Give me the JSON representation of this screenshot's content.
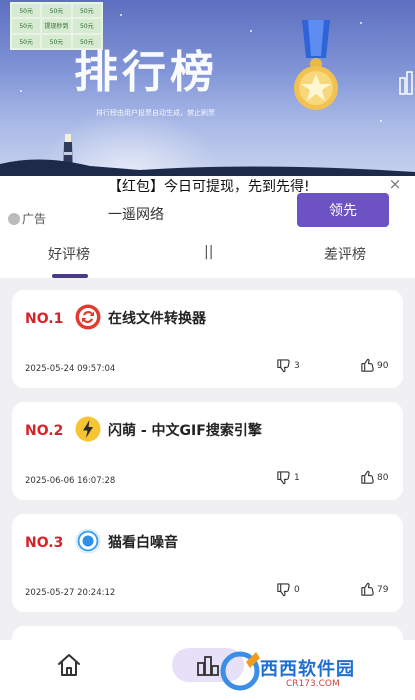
{
  "header": {
    "title": "排行榜",
    "subtitle": "排行榜由用户投票自动生成，禁止刷票"
  },
  "ad": {
    "title": "【红包】今日可提现，先到先得!",
    "brand": "一遥网络",
    "button_label": "领先",
    "label": "广告",
    "close": "×",
    "thumb_cells": [
      "50元",
      "50元",
      "50元",
      "50元",
      "提现秒到",
      "50元",
      "50元",
      "50元",
      "50元"
    ]
  },
  "tabs": {
    "good": "好评榜",
    "separator": "||",
    "bad": "差评榜"
  },
  "items": [
    {
      "rank": "NO.1",
      "name": "在线文件转换器",
      "date": "2025-05-24 09:57:04",
      "dislikes": "3",
      "likes": "90"
    },
    {
      "rank": "NO.2",
      "name": "闪萌 - 中文GIF搜索引擎",
      "date": "2025-06-06 16:07:28",
      "dislikes": "1",
      "likes": "80"
    },
    {
      "rank": "NO.3",
      "name": "猫看白噪音",
      "date": "2025-05-27 20:24:12",
      "dislikes": "0",
      "likes": "79"
    }
  ],
  "watermark": {
    "text": "西西软件园",
    "sub": "CR173.COM"
  },
  "colors": {
    "accent": "#4b3b86",
    "rank_red": "#d4242a",
    "ad_button": "#6d52c4"
  }
}
